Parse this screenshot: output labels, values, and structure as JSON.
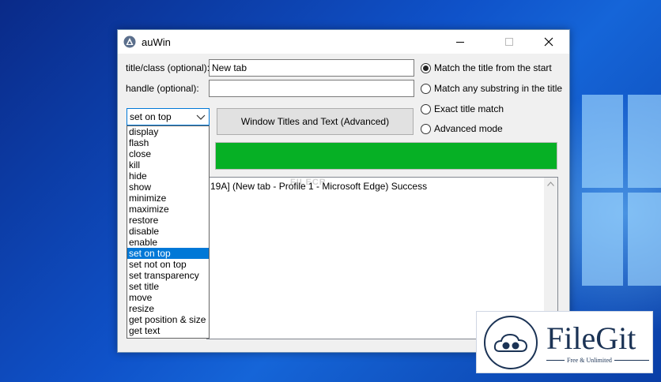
{
  "window": {
    "title": "auWin",
    "controls": {
      "minimize": "minimize",
      "maximize": "maximize",
      "close": "close"
    }
  },
  "form": {
    "title_label": "title/class (optional):",
    "title_value": "New tab",
    "handle_label": "handle (optional):",
    "handle_value": ""
  },
  "radios": [
    {
      "label": "Match the title from the start",
      "checked": true
    },
    {
      "label": "Match any substring in the title",
      "checked": false
    },
    {
      "label": "Exact title match",
      "checked": false
    },
    {
      "label": "Advanced mode",
      "checked": false
    }
  ],
  "action_combo": {
    "selected": "set on top",
    "options": [
      "display",
      "flash",
      "close",
      "kill",
      "hide",
      "show",
      "minimize",
      "maximize",
      "restore",
      "disable",
      "enable",
      "set on top",
      "set not on top",
      "set transparency",
      "set title",
      "move",
      "resize",
      "get position & size",
      "get text"
    ]
  },
  "advanced_button": {
    "label": "Window Titles and Text (Advanced)"
  },
  "progress": {
    "value": 1.0,
    "color": "#06b025"
  },
  "log": {
    "line": "19A] (New tab - Profile 1 - Microsoft Edge) Success"
  },
  "watermark": {
    "text": "FILECR"
  },
  "badge": {
    "name": "FileGit",
    "tagline": "Free & Unlimited"
  },
  "colors": {
    "accent": "#0078d7",
    "progress": "#06b025",
    "badge_navy": "#1b3355"
  }
}
